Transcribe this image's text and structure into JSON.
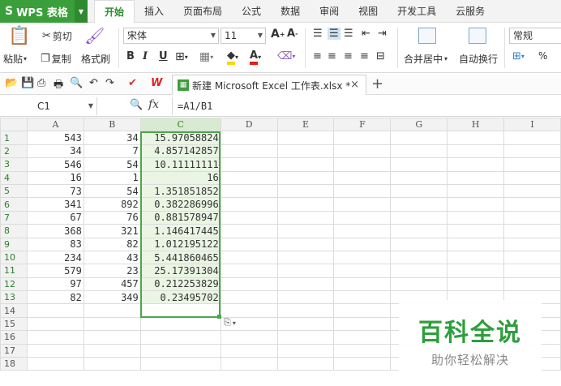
{
  "app": {
    "name": "WPS 表格",
    "colors": {
      "accent": "#3a9f3a",
      "selection_border": "#4ca64c",
      "selection_fill": "#eaf5e4",
      "watermark_green": "#2f9e3c"
    }
  },
  "menu": {
    "tabs": [
      "开始",
      "插入",
      "页面布局",
      "公式",
      "数据",
      "审阅",
      "视图",
      "开发工具",
      "云服务"
    ],
    "active_tab": "开始"
  },
  "ribbon": {
    "cut": "剪切",
    "paste": "粘贴",
    "copy": "复制",
    "format_painter": "格式刷",
    "font_name": "宋体",
    "font_size": "11",
    "bold": "B",
    "italic": "I",
    "underline": "U",
    "merge_center": "合并居中",
    "wrap_text": "自动换行",
    "number_format": "常规",
    "percent": "%"
  },
  "document": {
    "tab_title": "新建 Microsoft Excel 工作表.xlsx *"
  },
  "formula_bar": {
    "cell_ref": "C1",
    "fx": "fx",
    "formula": "=A1/B1"
  },
  "sheet": {
    "columns": [
      "A",
      "B",
      "C",
      "D",
      "E",
      "F",
      "G",
      "H",
      "I"
    ],
    "rows": [
      {
        "n": "1",
        "a": "543",
        "b": "34",
        "c": "15.97058824"
      },
      {
        "n": "2",
        "a": "34",
        "b": "7",
        "c": "4.857142857"
      },
      {
        "n": "3",
        "a": "546",
        "b": "54",
        "c": "10.11111111"
      },
      {
        "n": "4",
        "a": "16",
        "b": "1",
        "c": "16"
      },
      {
        "n": "5",
        "a": "73",
        "b": "54",
        "c": "1.351851852"
      },
      {
        "n": "6",
        "a": "341",
        "b": "892",
        "c": "0.382286996"
      },
      {
        "n": "7",
        "a": "67",
        "b": "76",
        "c": "0.881578947"
      },
      {
        "n": "8",
        "a": "368",
        "b": "321",
        "c": "1.146417445"
      },
      {
        "n": "9",
        "a": "83",
        "b": "82",
        "c": "1.012195122"
      },
      {
        "n": "10",
        "a": "234",
        "b": "43",
        "c": "5.441860465"
      },
      {
        "n": "11",
        "a": "579",
        "b": "23",
        "c": "25.17391304"
      },
      {
        "n": "12",
        "a": "97",
        "b": "457",
        "c": "0.212253829"
      },
      {
        "n": "13",
        "a": "82",
        "b": "349",
        "c": "0.23495702"
      },
      {
        "n": "14",
        "a": "",
        "b": "",
        "c": ""
      },
      {
        "n": "15",
        "a": "",
        "b": "",
        "c": ""
      },
      {
        "n": "16",
        "a": "",
        "b": "",
        "c": ""
      },
      {
        "n": "17",
        "a": "",
        "b": "",
        "c": ""
      },
      {
        "n": "18",
        "a": "",
        "b": "",
        "c": ""
      }
    ]
  },
  "watermark": {
    "title": "百科全说",
    "subtitle": "助你轻松解决"
  }
}
